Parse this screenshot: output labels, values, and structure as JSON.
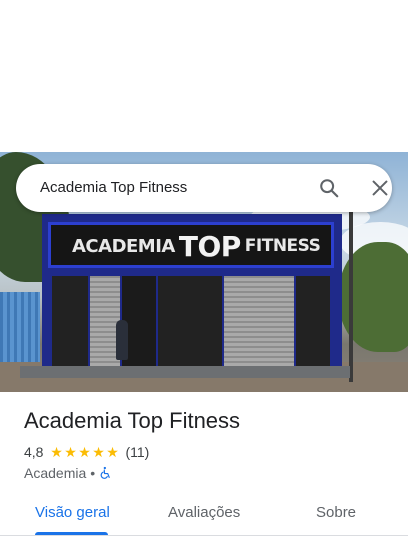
{
  "search": {
    "query": "Academia Top Fitness"
  },
  "photo": {
    "sign_academia": "ACADEMIA",
    "sign_top": "TOP",
    "sign_fitness": "FITNESS"
  },
  "place": {
    "title": "Academia Top Fitness",
    "rating": "4,8",
    "stars": 5,
    "review_count": "(11)",
    "category": "Academia",
    "separator": "•"
  },
  "tabs": [
    {
      "label": "Visão geral",
      "active": true
    },
    {
      "label": "Avaliações",
      "active": false
    },
    {
      "label": "Sobre",
      "active": false
    }
  ],
  "colors": {
    "accent": "#1a73e8",
    "star": "#fbbc04"
  },
  "icons": [
    "search-icon",
    "close-icon",
    "star-icon",
    "wheelchair-accessible-icon"
  ]
}
